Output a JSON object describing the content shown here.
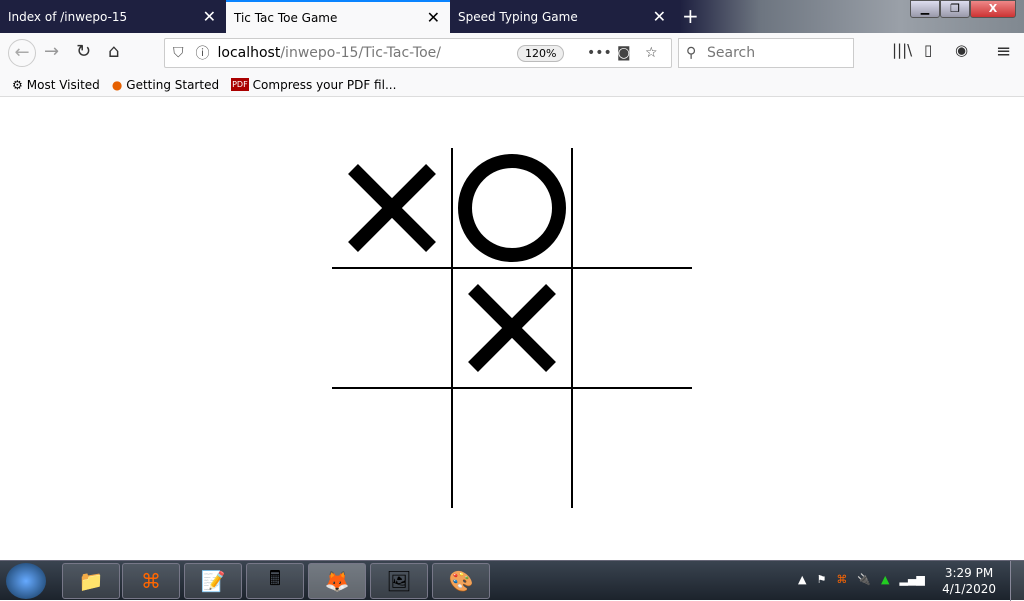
{
  "tabs": [
    {
      "label": "Index of /inwepo-15",
      "active": false
    },
    {
      "label": "Tic Tac Toe Game",
      "active": true
    },
    {
      "label": "Speed Typing Game",
      "active": false
    }
  ],
  "url": {
    "host": "localhost",
    "path": "/inwepo-15/Tic-Tac-Toe/",
    "zoom": "120%"
  },
  "search": {
    "placeholder": "Search"
  },
  "bookmarks": [
    {
      "label": "Most Visited"
    },
    {
      "label": "Getting Started"
    },
    {
      "label": "Compress your PDF fil..."
    }
  ],
  "board": [
    [
      "X",
      "O",
      ""
    ],
    [
      "",
      "X",
      ""
    ],
    [
      "",
      "",
      ""
    ]
  ],
  "taskbar": {
    "time": "3:29 PM",
    "date": "4/1/2020"
  }
}
